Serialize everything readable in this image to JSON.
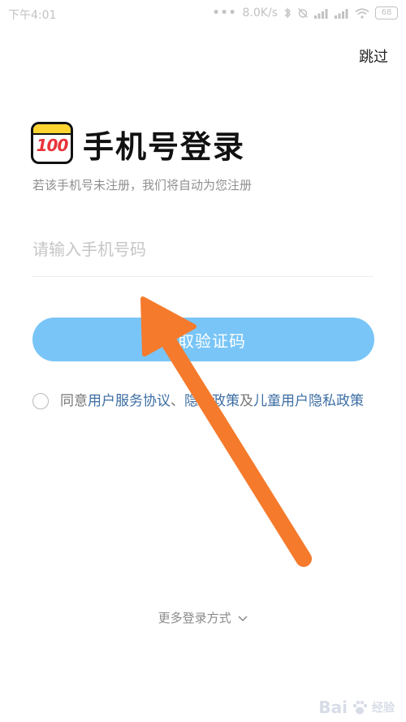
{
  "status_bar": {
    "time": "下午4:01",
    "net_speed": "8.0K/s",
    "battery": "68"
  },
  "header": {
    "skip_label": "跳过"
  },
  "logo": {
    "text": "100"
  },
  "login": {
    "title": "手机号登录",
    "subtitle": "若该手机号未注册，我们将自动为您注册",
    "phone_placeholder": "请输入手机号码",
    "get_code_label": "获取验证码"
  },
  "agreement": {
    "prefix": "同意",
    "user_service": "用户服务协议",
    "sep1": "、",
    "privacy": "隐私政策",
    "and": "及",
    "child_privacy": "儿童用户隐私政策"
  },
  "more_login": {
    "label": "更多登录方式"
  },
  "watermark": {
    "brand": "Bai",
    "sub": "经验"
  },
  "colors": {
    "accent_button": "#79c5f7",
    "link": "#3d6ea3",
    "annotation_arrow": "#f57a2c"
  }
}
